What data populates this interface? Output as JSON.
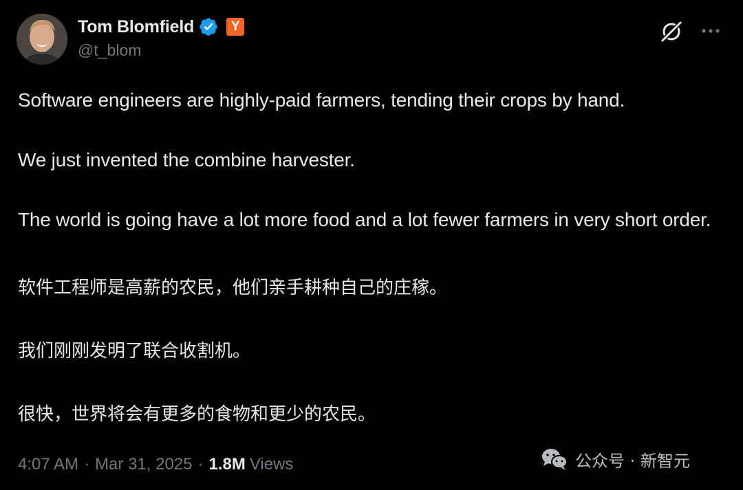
{
  "author": {
    "display_name": "Tom Blomfield",
    "handle": "@t_blom",
    "badge_letter": "Y",
    "verified": true
  },
  "header_actions": {
    "grok_icon": "grok-icon",
    "more_icon": "more-options-icon"
  },
  "tweet": {
    "paragraphs": [
      "Software engineers are highly-paid farmers, tending their crops by hand.",
      "We just invented the combine harvester.",
      "The world is going have a lot more food and a lot fewer farmers in very short order."
    ],
    "translation": [
      "软件工程师是高薪的农民，他们亲手耕种自己的庄稼。",
      "我们刚刚发明了联合收割机。",
      "很快，世界将会有更多的食物和更少的农民。"
    ]
  },
  "meta": {
    "time": "4:07 AM",
    "separator": "·",
    "date": "Mar 31, 2025",
    "views_count": "1.8M",
    "views_label": "Views"
  },
  "watermark": {
    "text": "公众号 · 新智元",
    "icon": "wechat-icon"
  },
  "colors": {
    "background": "#000000",
    "text_primary": "#e7e9ea",
    "text_secondary": "#71767b",
    "verified_blue": "#1d9bf0",
    "yc_orange": "#f26522"
  }
}
